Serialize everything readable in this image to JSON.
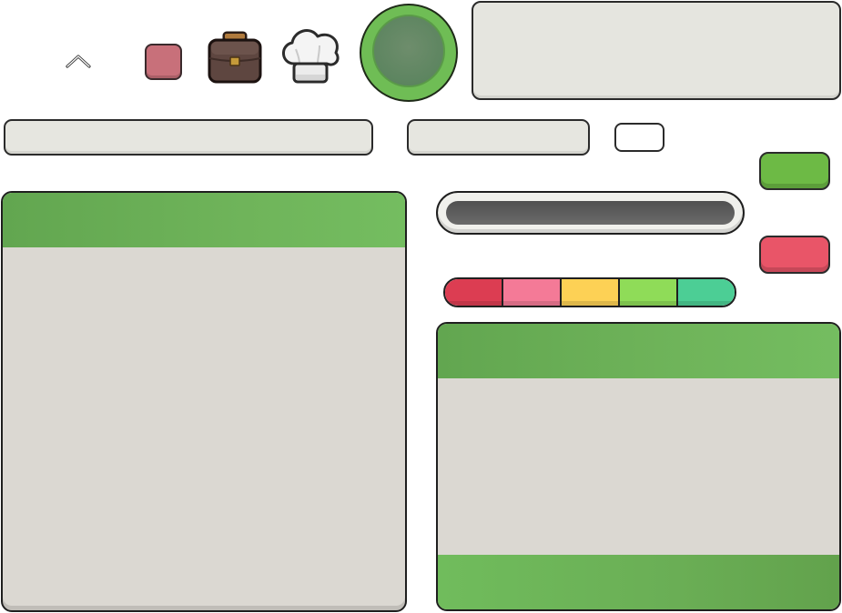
{
  "icons": {
    "chevron": "chevron-up-icon",
    "briefcase": "briefcase-icon",
    "chef_hat": "chef-hat-icon"
  },
  "colors": {
    "primary_green": "#6dba45",
    "danger_red": "#e95568",
    "square_button": "#c8707a",
    "panel_body": "#dbd8d2",
    "panel_header": "#6aae55",
    "input_fill": "#e6e6e0",
    "track_fill": "#5a5a5a"
  },
  "swatches": [
    "#dc3d52",
    "#f47a97",
    "#fdd155",
    "#8fdc58",
    "#4cce95"
  ]
}
